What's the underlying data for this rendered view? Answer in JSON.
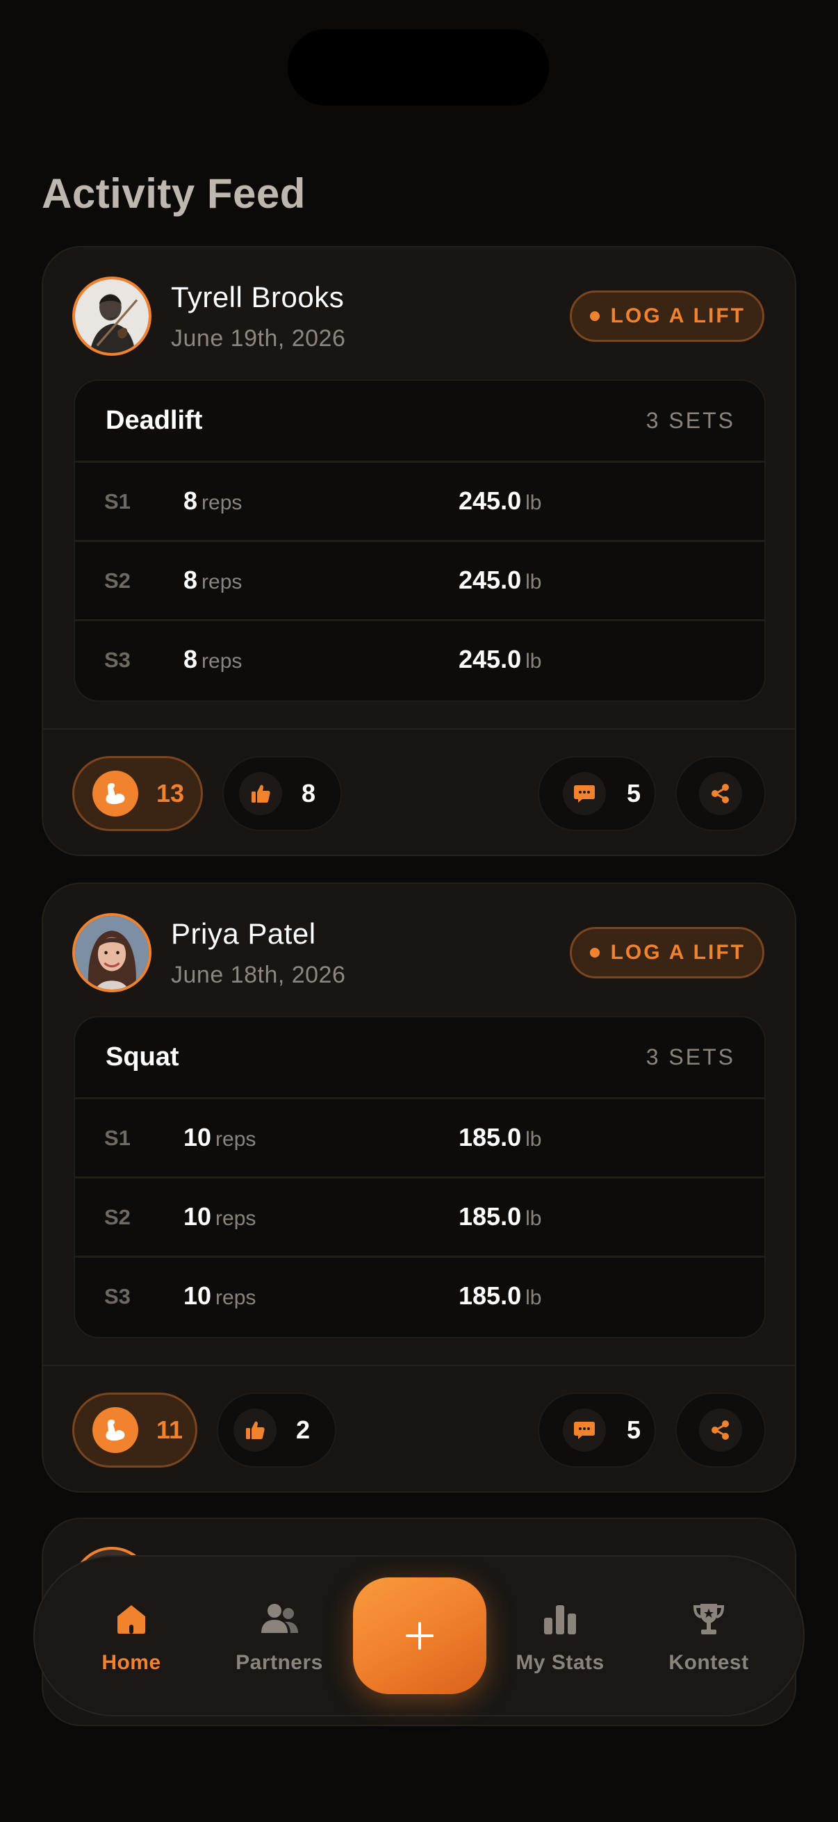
{
  "page": {
    "title": "Activity Feed"
  },
  "colors": {
    "accent": "#f2832e",
    "background": "#0b0a09",
    "card": "#181512"
  },
  "posts": [
    {
      "user": "Tyrell Brooks",
      "date": "June 19th, 2026",
      "action_label": "LOG A LIFT",
      "lift": {
        "name": "Deadlift",
        "sets_label": "3 SETS",
        "sets": [
          {
            "label": "S1",
            "reps": "8",
            "reps_unit": "reps",
            "weight": "245.0",
            "weight_unit": "lb"
          },
          {
            "label": "S2",
            "reps": "8",
            "reps_unit": "reps",
            "weight": "245.0",
            "weight_unit": "lb"
          },
          {
            "label": "S3",
            "reps": "8",
            "reps_unit": "reps",
            "weight": "245.0",
            "weight_unit": "lb"
          }
        ]
      },
      "flex_count": "13",
      "like_count": "8",
      "comment_count": "5"
    },
    {
      "user": "Priya Patel",
      "date": "June 18th, 2026",
      "action_label": "LOG A LIFT",
      "lift": {
        "name": "Squat",
        "sets_label": "3 SETS",
        "sets": [
          {
            "label": "S1",
            "reps": "10",
            "reps_unit": "reps",
            "weight": "185.0",
            "weight_unit": "lb"
          },
          {
            "label": "S2",
            "reps": "10",
            "reps_unit": "reps",
            "weight": "185.0",
            "weight_unit": "lb"
          },
          {
            "label": "S3",
            "reps": "10",
            "reps_unit": "reps",
            "weight": "185.0",
            "weight_unit": "lb"
          }
        ]
      },
      "flex_count": "11",
      "like_count": "2",
      "comment_count": "5"
    }
  ],
  "tabbar": {
    "home": "Home",
    "partners": "Partners",
    "stats": "My Stats",
    "kontest": "Kontest",
    "active": "home",
    "fab_icon": "plus-icon"
  }
}
